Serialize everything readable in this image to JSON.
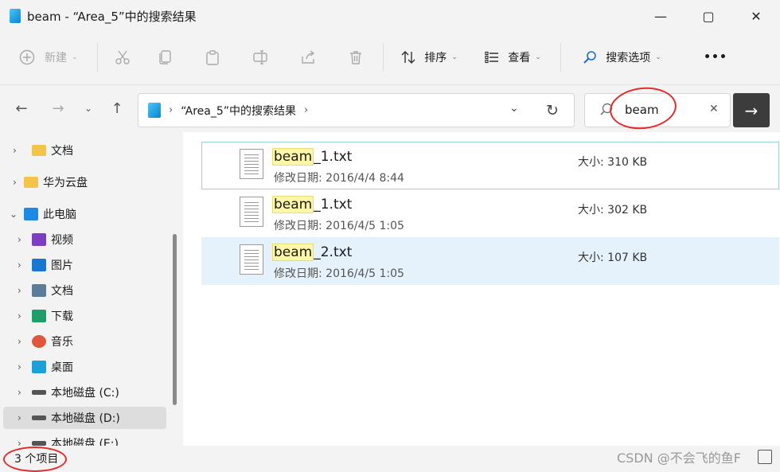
{
  "window": {
    "title": "beam - “Area_5”中的搜索结果",
    "minimize": "—",
    "maximize": "▢",
    "close": "✕"
  },
  "toolbar": {
    "new_label": "新建",
    "sort_label": "排序",
    "view_label": "查看",
    "search_options_label": "搜索选项",
    "more_label": "•••"
  },
  "nav": {
    "back": "←",
    "forward": "→",
    "recent": "⌄",
    "up": "↑",
    "path_label": "“Area_5”中的搜索结果",
    "refresh": "↻",
    "dropdown": "⌄"
  },
  "search": {
    "value": "beam",
    "clear": "✕",
    "go": "→"
  },
  "sidebar": {
    "items": [
      {
        "label": "文档",
        "icon": "folder-icon",
        "color": "#f4c34a"
      },
      {
        "label": "华为云盘",
        "icon": "folder-icon",
        "color": "#f4c34a"
      },
      {
        "label": "此电脑",
        "icon": "computer-icon",
        "color": "#1e88e5"
      },
      {
        "label": "视频",
        "icon": "video-icon",
        "color": "#7b3fbf"
      },
      {
        "label": "图片",
        "icon": "pictures-icon",
        "color": "#1976d2"
      },
      {
        "label": "文档",
        "icon": "documents-icon",
        "color": "#5c7c99"
      },
      {
        "label": "下载",
        "icon": "download-icon",
        "color": "#1e9e6a"
      },
      {
        "label": "音乐",
        "icon": "music-icon",
        "color": "#e0563c"
      },
      {
        "label": "桌面",
        "icon": "desktop-icon",
        "color": "#1ba0d8"
      },
      {
        "label": "本地磁盘 (C:)",
        "icon": "drive-c-icon",
        "color": "#555555"
      },
      {
        "label": "本地磁盘 (D:)",
        "icon": "drive-icon",
        "color": "#555555"
      },
      {
        "label": "本地磁盘 (E:)",
        "icon": "drive-icon",
        "color": "#555555"
      }
    ]
  },
  "files": [
    {
      "highlight": "beam",
      "rest": "_1.txt",
      "date_label": "修改日期:",
      "date": "2016/4/4 8:44",
      "size_label": "大小:",
      "size": "310 KB"
    },
    {
      "highlight": "beam",
      "rest": "_1.txt",
      "date_label": "修改日期:",
      "date": "2016/4/5 1:05",
      "size_label": "大小:",
      "size": "302 KB"
    },
    {
      "highlight": "beam",
      "rest": "_2.txt",
      "date_label": "修改日期:",
      "date": "2016/4/5 1:05",
      "size_label": "大小:",
      "size": "107 KB"
    }
  ],
  "status": {
    "count": "3 个项目"
  },
  "watermark": "CSDN @不会飞的鱼F",
  "colors": {
    "accent": "#0078d4",
    "selection": "#e5f1fb",
    "annotation": "#e32d2d"
  }
}
